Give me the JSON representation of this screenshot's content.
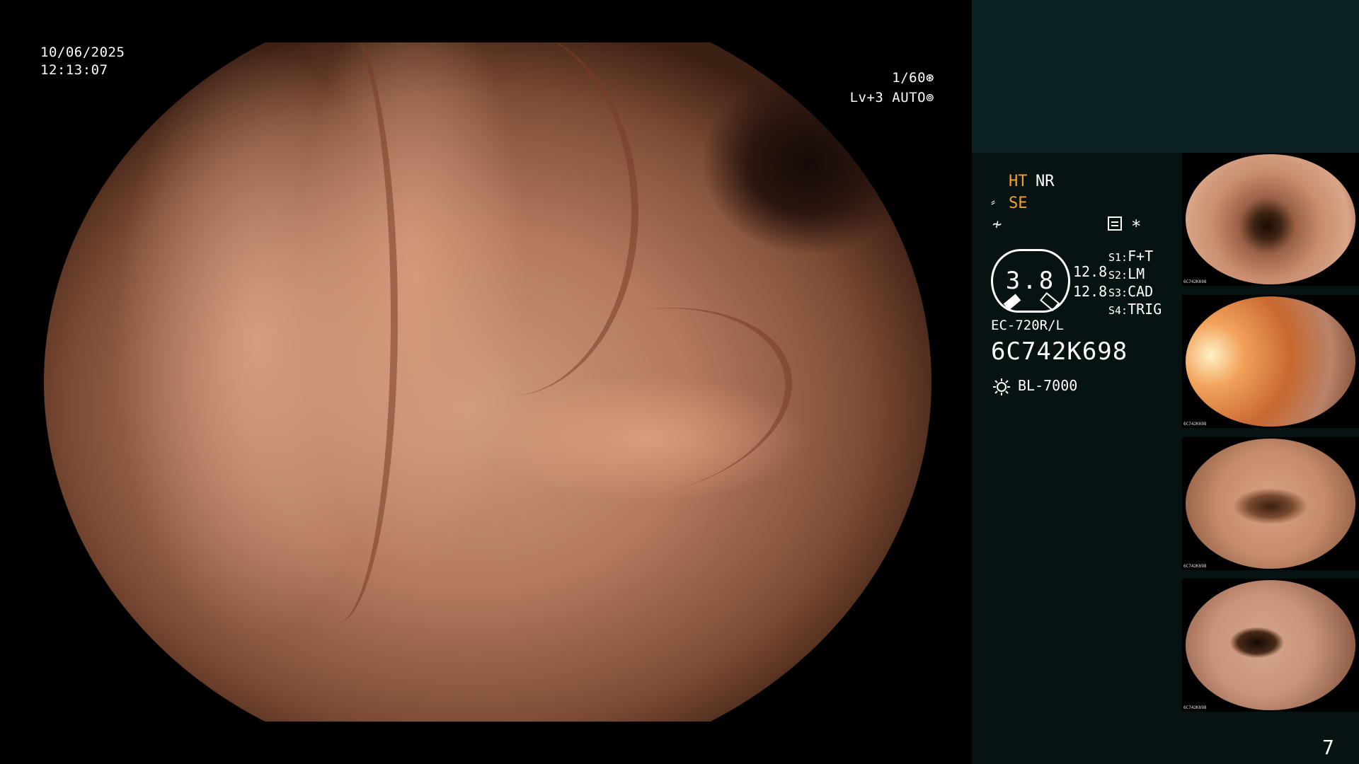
{
  "overlay": {
    "date": "10/06/2025",
    "time": "12:13:07",
    "shutter": "1/60",
    "shutter_icon": "aperture-icon",
    "level": "Lv+3 AUTO",
    "level_icon": "iris-icon"
  },
  "status": {
    "ht": "HT",
    "nr": "NR",
    "se": "SE",
    "se_icon": "edge-enhance-icon",
    "f_icon": "f-curve-icon",
    "menu_icon": "menu-icon",
    "star": "*",
    "colors": {
      "active": "#f2a12b",
      "normal": "#ffffff"
    }
  },
  "gauge": {
    "value": "3.8",
    "readout_1": "12.8",
    "readout_2": "12.8"
  },
  "switches": [
    {
      "key": "S1:",
      "value": "F+T"
    },
    {
      "key": "S2:",
      "value": "LM"
    },
    {
      "key": "S3:",
      "value": "CAD"
    },
    {
      "key": "S4:",
      "value": "TRIG"
    }
  ],
  "scope": {
    "model": "EC-720R/L",
    "serial": "6C742K698",
    "light_source": "BL-7000",
    "light_icon": "sun-icon"
  },
  "thumbnails": [
    {
      "stamp": "6C742K698"
    },
    {
      "stamp": "6C742K698"
    },
    {
      "stamp": "6C742K698"
    },
    {
      "stamp": "6C742K698"
    }
  ],
  "page_number": "7",
  "colors": {
    "panel_bg": "#071212",
    "panel_header_bg": "#0c2223"
  }
}
